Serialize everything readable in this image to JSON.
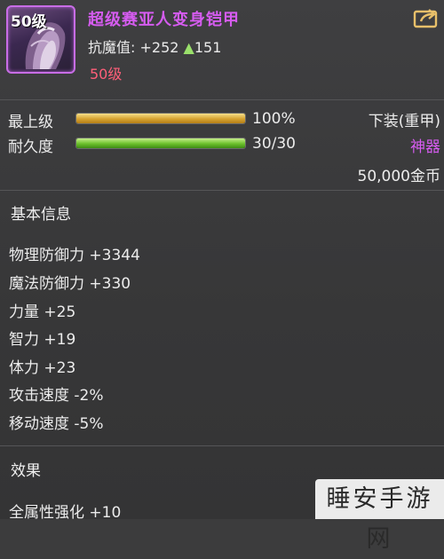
{
  "item": {
    "level_badge": "50级",
    "name": "超级赛亚人变身铠甲",
    "resist_label": "抗魔值:",
    "resist_value": "+252",
    "resist_arrow": "▲",
    "resist_increase": "151",
    "level_req": "50级"
  },
  "stats": {
    "upgrade_label": "最上级",
    "upgrade_text": "100%",
    "upgrade_fraction": 1.0,
    "durability_label": "耐久度",
    "durability_text": "30/30",
    "durability_fraction": 1.0,
    "slot": "下装(重甲)",
    "rarity": "神器",
    "price": "50,000金币"
  },
  "basic_info": {
    "title": "基本信息",
    "attributes": [
      "物理防御力 +3344",
      "魔法防御力 +330",
      "力量 +25",
      "智力 +19",
      "体力 +23",
      "攻击速度 -2%",
      "移动速度 -5%"
    ]
  },
  "effects": {
    "title": "效果",
    "lines": [
      "全属性强化 +10"
    ]
  },
  "watermark": "睡安手游网",
  "colors": {
    "item_name": "#d65cf0",
    "rarity": "#d65cf0",
    "level_req": "#ff5f79",
    "resist_up": "#9ae06b",
    "frame": "#c86de6"
  },
  "icons": {
    "item": "armor-icon",
    "share": "share-icon"
  }
}
